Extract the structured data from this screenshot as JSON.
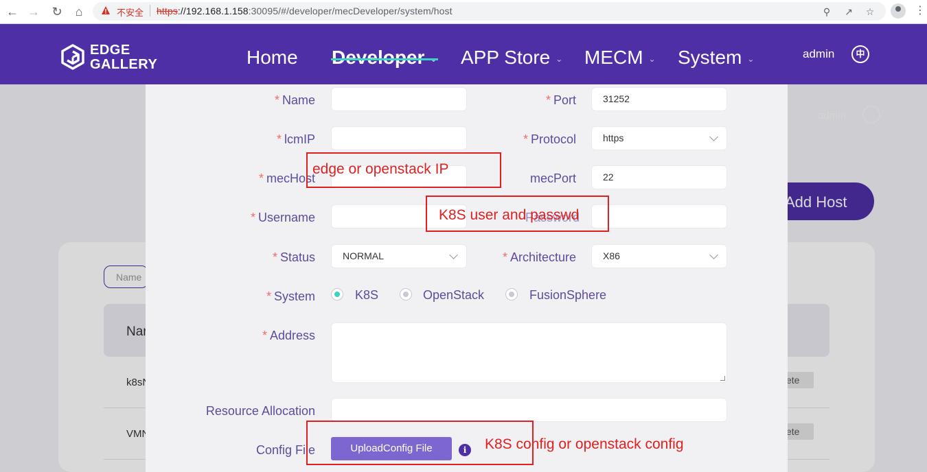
{
  "browser": {
    "security_label": "不安全",
    "url_scheme": "https",
    "url_host": "://192.168.1.158",
    "url_rest": ":30095/#/developer/mecDeveloper/system/host"
  },
  "header": {
    "logo_line1": "EDGE",
    "logo_line2": "GALLERY",
    "menu": [
      {
        "label": "Home"
      },
      {
        "label": "Developer"
      },
      {
        "label": "APP Store"
      },
      {
        "label": "MECM"
      },
      {
        "label": "System"
      }
    ],
    "user": "admin",
    "lang": "中"
  },
  "background_page": {
    "add_button": "Add Host",
    "search_placeholder": "Name",
    "table_header_first": "Nar",
    "rows": [
      "k8sN",
      "VMN"
    ],
    "delete_label": "ete",
    "user": "admin"
  },
  "form": {
    "name": {
      "label": "Name",
      "value": ""
    },
    "port": {
      "label": "Port",
      "value": "31252"
    },
    "lcmip": {
      "label": "lcmIP",
      "value": ""
    },
    "protocol": {
      "label": "Protocol",
      "value": "https"
    },
    "mechost": {
      "label": "mecHost",
      "value": ""
    },
    "mecport": {
      "label": "mecPort",
      "value": "22"
    },
    "username": {
      "label": "Username",
      "value": ""
    },
    "password": {
      "label": "Password",
      "value": ""
    },
    "status": {
      "label": "Status",
      "value": "NORMAL"
    },
    "architecture": {
      "label": "Architecture",
      "value": "X86"
    },
    "system": {
      "label": "System",
      "options": [
        "K8S",
        "OpenStack",
        "FusionSphere"
      ],
      "selected": "K8S"
    },
    "address": {
      "label": "Address",
      "value": ""
    },
    "resource_allocation": {
      "label": "Resource Allocation",
      "value": ""
    },
    "config_file": {
      "label": "Config File",
      "button": "UploadConfig File",
      "info": "i"
    }
  },
  "annotations": {
    "mechost_note": "edge or openstack IP",
    "credentials_note": "K8S user and passwd",
    "config_note": "K8S config or openstack config"
  },
  "colors": {
    "header": "#4e2fa5",
    "accent": "#38d6c1",
    "label": "#5e4b9b",
    "required": "#f56c6c",
    "annotation": "#e02020"
  }
}
